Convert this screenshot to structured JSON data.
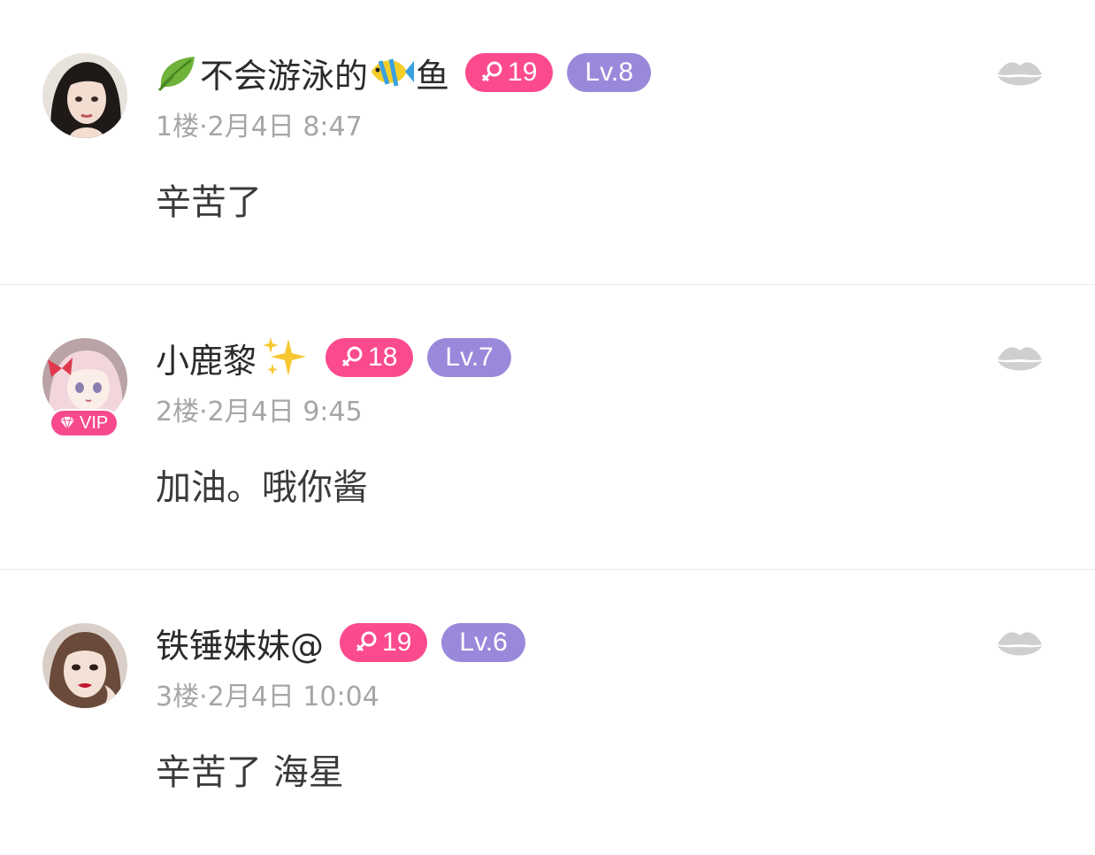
{
  "comments": [
    {
      "avatar_icon": "avatar-dark-hair-girl-icon",
      "name_prefix_emoji": "leaf-icon",
      "name_part1": "不会游泳的",
      "name_mid_emoji": "tropical-fish-icon",
      "name_part2": "鱼",
      "gender_icon": "female-symbol-icon",
      "age": "19",
      "level": "Lv.8",
      "meta": "1楼·2月4日 8:47",
      "content": "辛苦了",
      "like_icon": "lips-icon"
    },
    {
      "avatar_icon": "avatar-anime-girl-pink-hair-icon",
      "vip_label": "VIP",
      "name_part1": "小鹿黎",
      "name_suffix_emoji": "sparkles-icon",
      "gender_icon": "female-symbol-icon",
      "age": "18",
      "level": "Lv.7",
      "meta": "2楼·2月4日 9:45",
      "content": "加油。哦你酱",
      "like_icon": "lips-icon"
    },
    {
      "avatar_icon": "avatar-girl-red-lips-icon",
      "name_part1": "铁锤妹妹@",
      "gender_icon": "female-symbol-icon",
      "age": "19",
      "level": "Lv.6",
      "meta": "3楼·2月4日 10:04",
      "content": "辛苦了 海星",
      "like_icon": "lips-icon"
    }
  ],
  "colors": {
    "gender_badge": "#fc4a8e",
    "level_badge": "#9a88db",
    "vip_badge": "#f74a8c",
    "meta_text": "#a6a6a6",
    "name_text": "#2b2b2b",
    "content_text": "#3a3a3a",
    "lips_icon": "#cfcfcf",
    "divider": "#ececec"
  }
}
